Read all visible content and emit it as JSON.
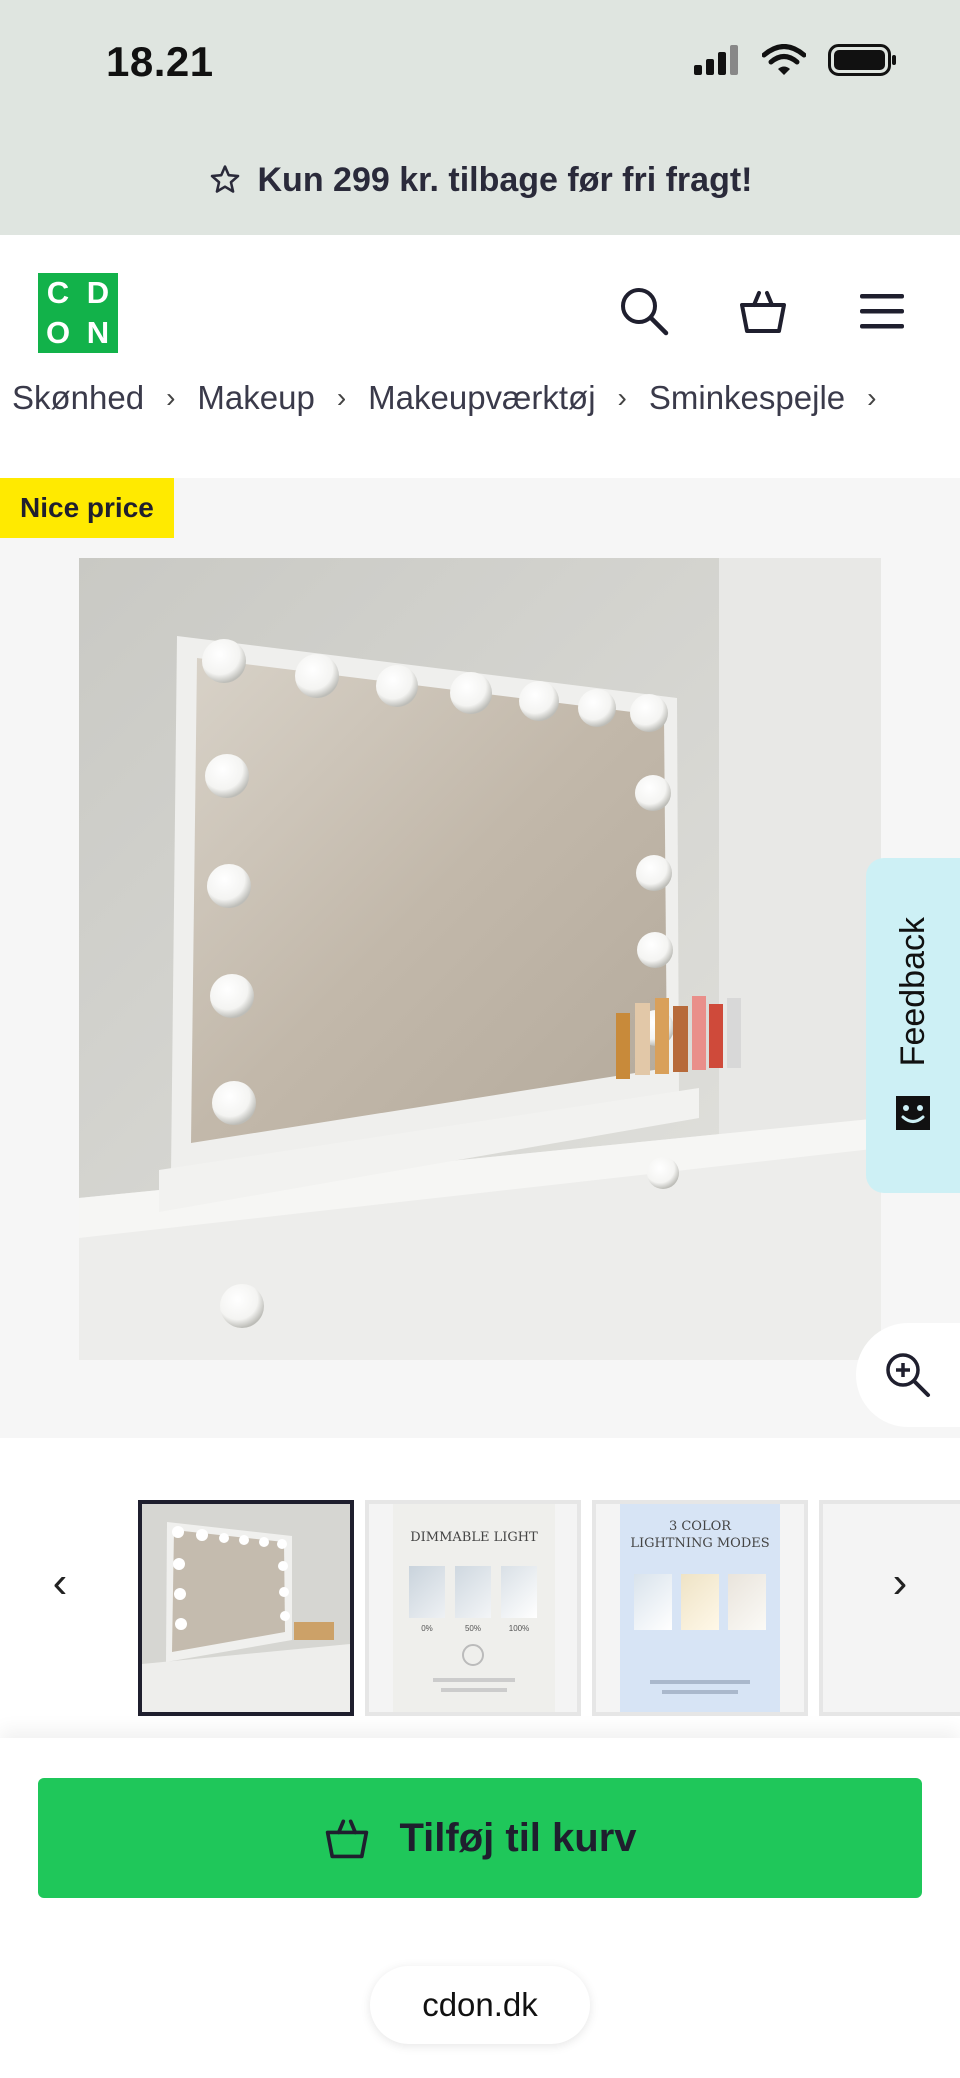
{
  "status": {
    "time": "18.21"
  },
  "promo": {
    "text": "Kun 299 kr. tilbage før fri fragt!",
    "icon": "star-icon"
  },
  "header": {
    "logo_letters": [
      "C",
      "D",
      "O",
      "N"
    ],
    "brand_color": "#12b24a",
    "icons": [
      "search-icon",
      "basket-icon",
      "menu-icon"
    ]
  },
  "breadcrumb": {
    "items": [
      "Skønhed",
      "Makeup",
      "Makeupværktøj",
      "Sminkespejle"
    ]
  },
  "product": {
    "badge": "Nice price",
    "badge_color": "#ffea00"
  },
  "feedback": {
    "label": "Feedback"
  },
  "thumbnails": [
    {
      "title": "",
      "captions": []
    },
    {
      "title": "DIMMABLE LIGHT",
      "captions": [
        "0%",
        "50%",
        "100%"
      ]
    },
    {
      "title": "3 COLOR LIGHTNING MODES",
      "captions": []
    }
  ],
  "actions": {
    "add_to_cart": "Tilføj til kurv",
    "button_color": "#1fc75a"
  },
  "browser": {
    "url": "cdon.dk"
  }
}
